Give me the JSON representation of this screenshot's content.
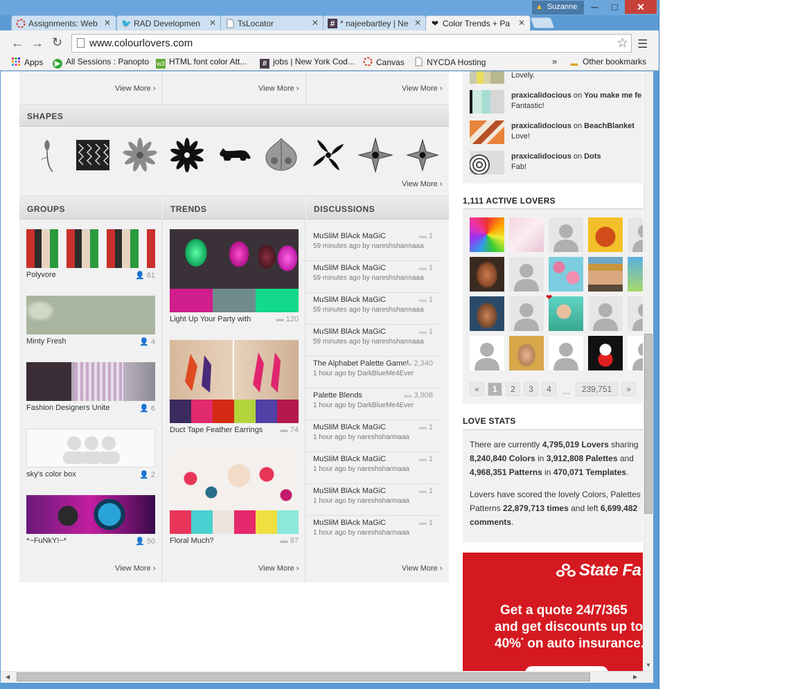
{
  "window": {
    "user": "Suzanne",
    "minimize": "─",
    "maximize": "□",
    "close": "✕"
  },
  "tabs": [
    {
      "label": "Assignments: Web",
      "icon": "canvas-icon"
    },
    {
      "label": "RAD Developmen",
      "icon": "twitter-icon"
    },
    {
      "label": "TsLocator",
      "icon": "page-icon"
    },
    {
      "label": "* najeebartley | Ne",
      "icon": "slack-icon"
    },
    {
      "label": "Color Trends + Pa",
      "icon": "hearts-icon",
      "active": true
    }
  ],
  "address": {
    "url": "www.colourlovers.com"
  },
  "bookmarks": [
    {
      "label": "Apps",
      "icon": "apps-grid-icon"
    },
    {
      "label": "All Sessions : Panopto",
      "icon": "panopto-icon"
    },
    {
      "label": "HTML font color Att...",
      "icon": "w3-icon"
    },
    {
      "label": "jobs | New York Cod...",
      "icon": "slack-icon"
    },
    {
      "label": "Canvas",
      "icon": "canvas-icon"
    },
    {
      "label": "NYCDA Hosting",
      "icon": "page-icon"
    }
  ],
  "bookmarks_more": "»",
  "other_bookmarks": "Other bookmarks",
  "main": {
    "view_more": "View More ›",
    "shapes_title": "SHAPES",
    "groups_title": "GROUPS",
    "trends_title": "TRENDS",
    "discussions_title": "DISCUSSIONS",
    "groups": [
      {
        "title": "Polyvore",
        "count": "61"
      },
      {
        "title": "Minty Fresh",
        "count": "4"
      },
      {
        "title": "Fashion Designers Unite",
        "count": "6"
      },
      {
        "title": "sky's color box",
        "count": "2"
      },
      {
        "title": "*~FuNkY!~*",
        "count": "50"
      }
    ],
    "trends": [
      {
        "title": "Light Up Your Party with",
        "count": "120",
        "colors": [
          "#d01e8c",
          "#6f8b8c",
          "#13d98b"
        ]
      },
      {
        "title": "Duct Tape Feather Earrings",
        "count": "74",
        "colors": [
          "#3c2b5e",
          "#e02a6e",
          "#d42a14",
          "#b3d43a",
          "#5141a6",
          "#b4184c"
        ]
      },
      {
        "title": "Floral Much?",
        "count": "97",
        "colors": [
          "#e8355a",
          "#49d1d1",
          "#ece4dc",
          "#e6286c",
          "#efdf40",
          "#8be8db"
        ]
      }
    ],
    "discussions": [
      {
        "title": "MuSliM BlAck MaGiC",
        "meta": "59 minutes ago by nareshsharmaaa",
        "count": "1"
      },
      {
        "title": "MuSliM BlAck MaGiC",
        "meta": "59 minutes ago by nareshsharmaaa",
        "count": "1"
      },
      {
        "title": "MuSliM BlAck MaGiC",
        "meta": "59 minutes ago by nareshsharmaaa",
        "count": "1"
      },
      {
        "title": "MuSliM BlAck MaGiC",
        "meta": "59 minutes ago by nareshsharmaaa",
        "count": "1"
      },
      {
        "title": "The Alphabet Palette Game!",
        "meta": "1 hour ago by DarkBlueMe4Ever",
        "count": "2,340"
      },
      {
        "title": "Palette Blends",
        "meta": "1 hour ago by DarkBlueMe4Ever",
        "count": "3,908"
      },
      {
        "title": "MuSliM BlAck MaGiC",
        "meta": "1 hour ago by nareshsharmaaa",
        "count": "1"
      },
      {
        "title": "MuSliM BlAck MaGiC",
        "meta": "1 hour ago by nareshsharmaaa",
        "count": "1"
      },
      {
        "title": "MuSliM BlAck MaGiC",
        "meta": "1 hour ago by nareshsharmaaa",
        "count": "1"
      },
      {
        "title": "MuSliM BlAck MaGiC",
        "meta": "1 hour ago by nareshsharmaaa",
        "count": "1"
      }
    ]
  },
  "sidebar": {
    "activity": [
      {
        "user": "",
        "connector": "",
        "target": "",
        "comment": "Lovely."
      },
      {
        "user": "praxicalidocious",
        "connector": " on ",
        "target": "You make me fe",
        "comment": "Fantastic!"
      },
      {
        "user": "praxicalidocious",
        "connector": " on ",
        "target": "BeachBlanket",
        "comment": "Love!"
      },
      {
        "user": "praxicalidocious",
        "connector": " on ",
        "target": "Dots",
        "comment": "Fab!"
      }
    ],
    "active_lovers_title": "1,111 ACTIVE LOVERS",
    "pagination": {
      "prev": "«",
      "pages": [
        "1",
        "2",
        "3",
        "4"
      ],
      "ellipsis": "...",
      "last": "239,751",
      "next": "»"
    },
    "love_stats_title": "LOVE STATS",
    "stats": {
      "l1_a": "There are currently ",
      "lovers": "4,795,019 Lovers",
      "l1_b": " sharing",
      "colors": "8,240,840 Colors",
      "l2_a": " in ",
      "palettes": "3,912,808 Palettes",
      "l2_b": " and",
      "patterns": "4,968,351 Patterns",
      "l3_a": " in ",
      "templates": "470,071 Templates",
      "l3_b": ".",
      "l4": "Lovers have scored the lovely Colors, Palettes",
      "l5_a": "Patterns ",
      "times": "22,879,713 times",
      "l5_b": " and left ",
      "comments_n": "6,699,482",
      "comments_w": "comments",
      "l6_b": "."
    }
  },
  "ad": {
    "brand": "State Fa",
    "line1": "Get a quote 24/7/365",
    "line2": "and get discounts up to",
    "line3a": "40%",
    "line3b": "*",
    "line3c": " on auto insurance."
  }
}
